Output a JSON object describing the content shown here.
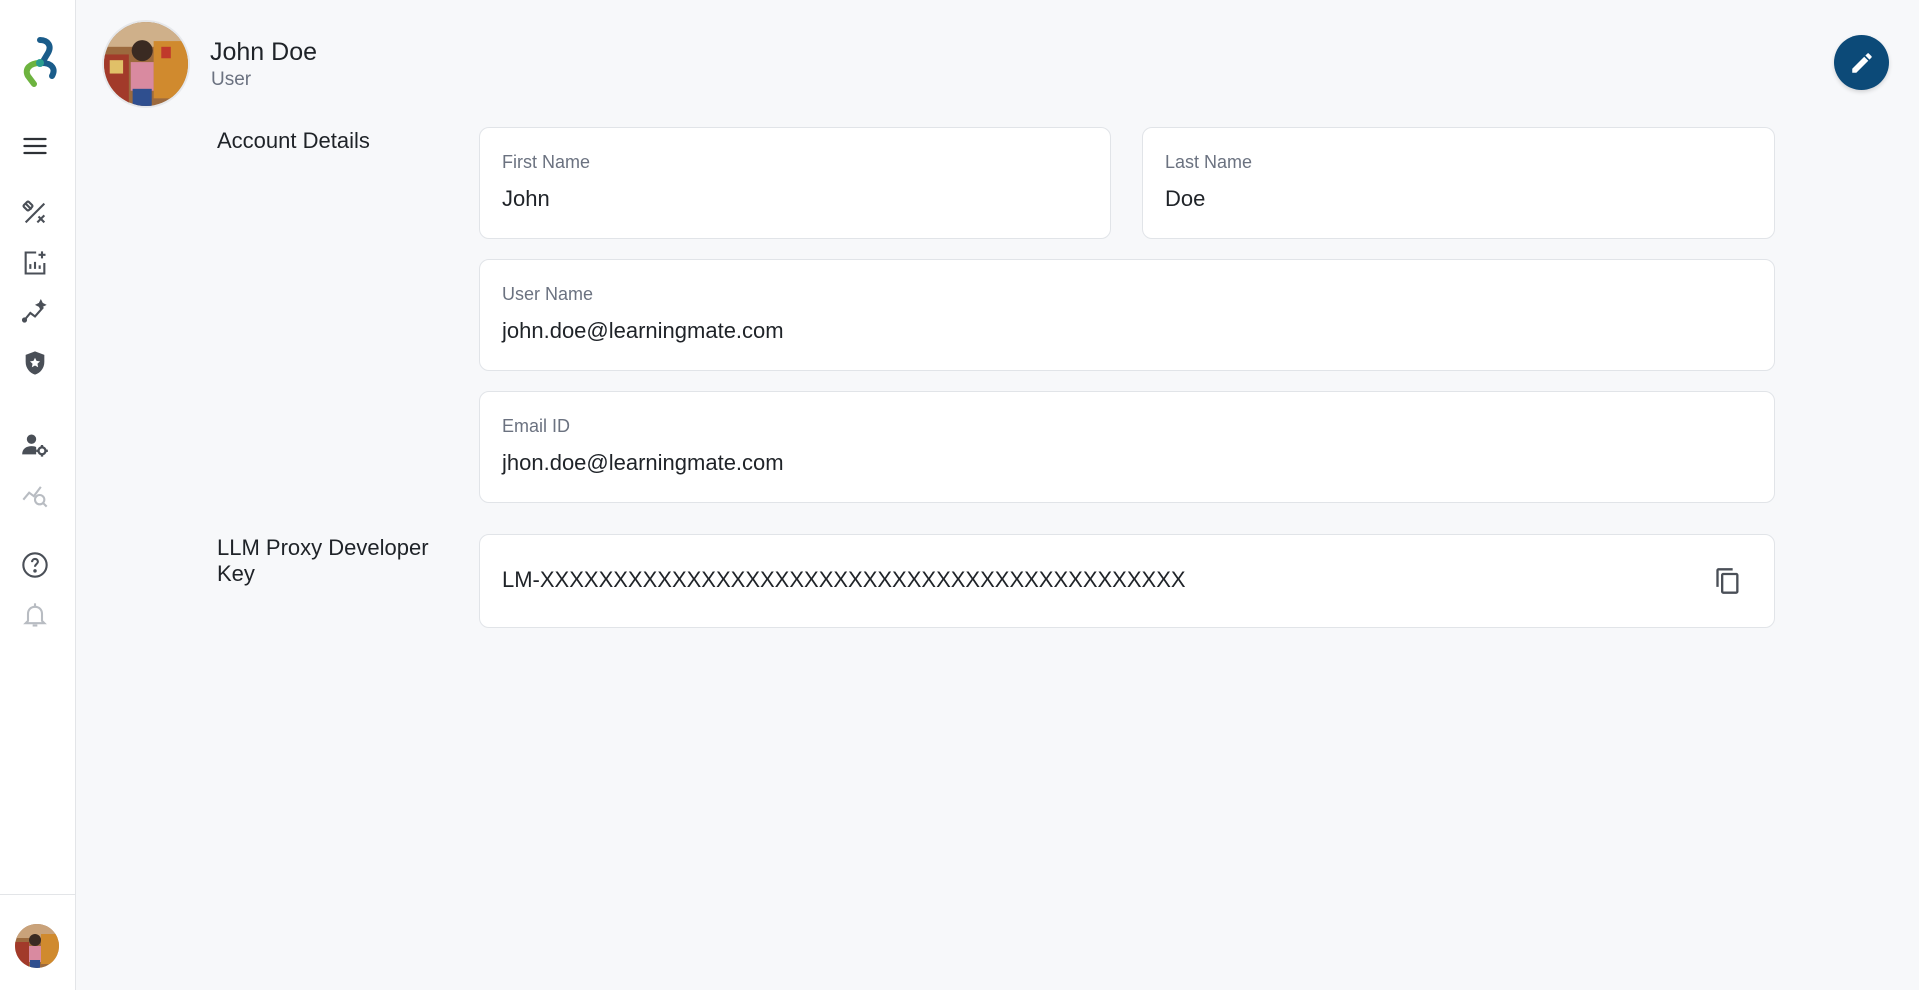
{
  "sidebar": {
    "items": [
      {
        "name": "menu"
      },
      {
        "name": "design-tools"
      },
      {
        "name": "add-report"
      },
      {
        "name": "ai-analytics"
      },
      {
        "name": "security"
      },
      {
        "name": "user-settings"
      },
      {
        "name": "analytics-search"
      },
      {
        "name": "help"
      },
      {
        "name": "notifications"
      }
    ]
  },
  "header": {
    "name": "John Doe",
    "role": "User"
  },
  "account": {
    "section_label": "Account Details",
    "first_name_label": "First Name",
    "first_name_value": "John",
    "last_name_label": "Last Name",
    "last_name_value": "Doe",
    "username_label": "User Name",
    "username_value": "john.doe@learningmate.com",
    "email_label": "Email ID",
    "email_value": "jhon.doe@learningmate.com"
  },
  "developer_key": {
    "section_label": "LLM Proxy Developer Key",
    "value": "LM-XXXXXXXXXXXXXXXXXXXXXXXXXXXXXXXXXXXXXXXXXXXX"
  },
  "colors": {
    "accent": "#0c4a78",
    "icon": "#4a4f57",
    "icon_muted": "#b8bcc2"
  }
}
